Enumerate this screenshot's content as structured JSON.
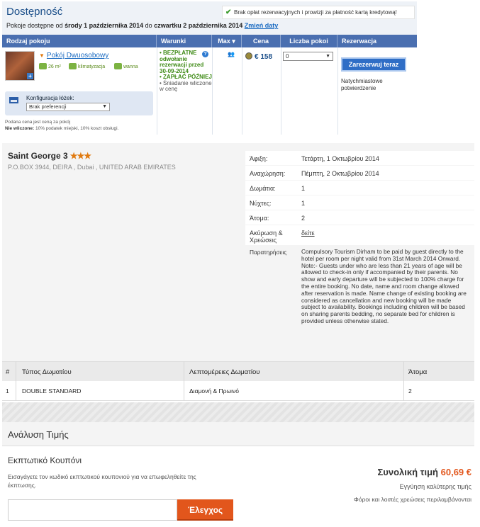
{
  "availability": {
    "title": "Dostępność",
    "notice": "Brak opłat rezerwacyjnych i prowizji za płatność kartą kredytową!",
    "dates_prefix": "Pokoje dostępne od",
    "date_from": "środy 1 października 2014",
    "dates_mid": "do",
    "date_to": "czwartku 2 października 2014",
    "change_dates": "Zmień daty",
    "columns": [
      "Rodzaj pokoju",
      "Warunki",
      "Max ▾",
      "Cena",
      "Liczba pokoi",
      "Rezerwacja"
    ],
    "room": {
      "name": "Pokój Dwuosobowy",
      "amenities": [
        "26 m²",
        "klimatyzacja",
        "wanna"
      ],
      "bed_config_label": "Konfiguracja łóżek:",
      "bed_config_value": "Brak preferencji",
      "price_note_line1": "Podana cena jest ceną za pokój",
      "price_note_bold": "Nie wliczone:",
      "price_note_line2": "10% podatek miejski, 10% koszt obsługi."
    },
    "terms": {
      "free_cancel": "BEZPŁATNE odwołanie rezerwacji przed 30-09-2014",
      "pay_later": "ZAPŁAĆ PÓŹNIEJ",
      "breakfast": "Śniadanie wliczone w cenę"
    },
    "max_icon": "guests-icon",
    "price": "€ 158",
    "qty_value": "0",
    "book_button": "Zarezerwuj teraz",
    "instant_confirm": "Natychmiastowe potwierdzenie"
  },
  "hotel": {
    "name": "Saint George 3",
    "stars": "★★★",
    "address": "P.O.BOX 3944, DEIRA , Dubai , UNITED ARAB EMIRATES",
    "info": [
      {
        "label": "Άφιξη:",
        "value": "Τετάρτη, 1 Οκτωβρίου 2014"
      },
      {
        "label": "Αναχώρηση:",
        "value": "Πέμπτη, 2 Οκτωβρίου 2014"
      },
      {
        "label": "Δωμάτια:",
        "value": "1"
      },
      {
        "label": "Νύχτες:",
        "value": "1"
      },
      {
        "label": "Άτομα:",
        "value": "2"
      },
      {
        "label": "Ακύρωση & Χρεώσεις",
        "value": "δείτε"
      }
    ],
    "remarks_label": "Παρατηρήσεις",
    "remarks_text": "Compulsory Tourism Dirham to be paid by guest directly to the hotel per room per night valid from 31st March 2014 Onward. Note:- Guests under who are less than 21 years of age will be allowed to check-in only if accompanied by their parents. No show and early departure will be subjected to 100% charge for the entire booking. No date, name and room change allowed after reservation is made. Name change of existing booking are considered as cancellation and new booking will be made subject to availability. Bookings including children will be based on sharing parents bedding, no separate bed for children is provided unless otherwise stated."
  },
  "rooms_table": {
    "headers": [
      "#",
      "Τύπος Δωματίου",
      "Λεπτομέρειες Δωματίου",
      "Άτομα"
    ],
    "rows": [
      [
        "1",
        "DOUBLE STANDARD",
        "Διαμονή & Πρωινό",
        "2"
      ]
    ]
  },
  "pricing": {
    "analysis_title": "Ανάλυση Τιμής",
    "coupon_title": "Εκπτωτικό Κουπόνι",
    "coupon_desc": "Εισαγάγετε τον κωδικό εκπτωτικού κουπονιού για να επωφεληθείτε της έκπτωσης.",
    "coupon_placeholder": "",
    "check_button": "Έλεγχος",
    "total_label": "Συνολική τιμή",
    "total_amount": "60,69 €",
    "guarantee": "Εγγύηση καλύτερης τιμής",
    "taxes": "Φόροι και λοιπές χρεώσεις περιλαμβάνονται"
  },
  "colors": {
    "brand_blue": "#4a6fb0",
    "accent_orange": "#e2561c",
    "link_blue": "#1a6bc2"
  }
}
